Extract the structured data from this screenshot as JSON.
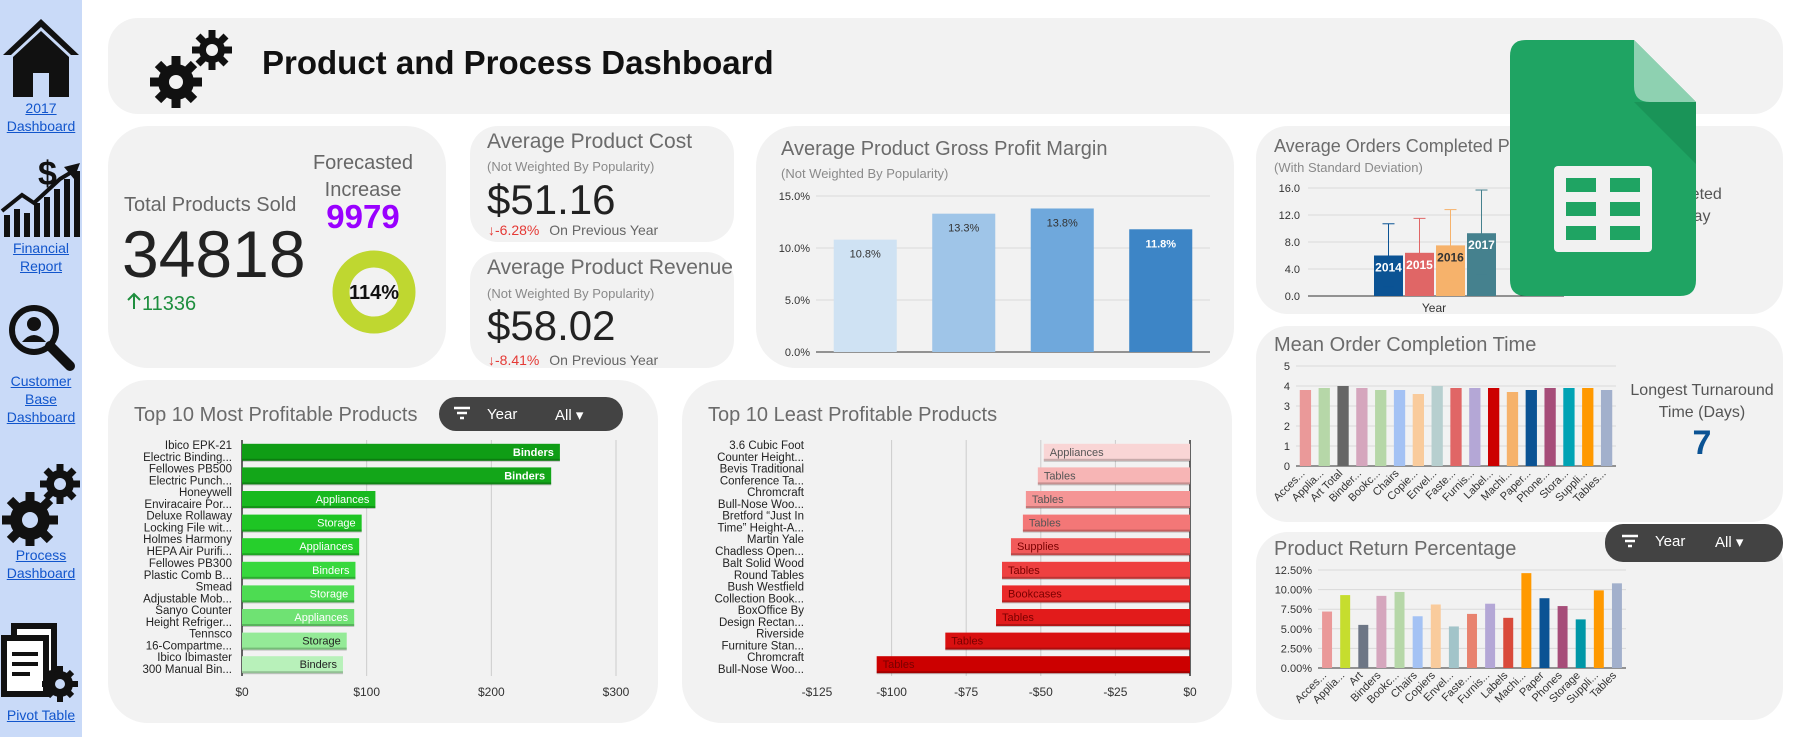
{
  "sidebar": {
    "items": [
      {
        "label1": "2017",
        "label2": "Dashboard",
        "icon": "house-icon"
      },
      {
        "label1": "Financial",
        "label2": "Report",
        "icon": "finance-chart-icon"
      },
      {
        "label1": "Customer",
        "label2": "Base",
        "label3": "Dashboard",
        "icon": "magnifier-user-icon"
      },
      {
        "label1": "Process",
        "label2": "Dashboard",
        "icon": "gears-icon"
      },
      {
        "label1": "Pivot Table",
        "icon": "documents-gear-icon"
      }
    ]
  },
  "header": {
    "title": "Product and Process Dashboard",
    "icon": "gears-icon"
  },
  "overlay_icon": "google-sheets-icon",
  "kpis": {
    "total_sold_label": "Total Products Sold",
    "total_sold": "34818",
    "total_sold_change": "11336",
    "forecast_label1": "Forecasted",
    "forecast_label2": "Increase",
    "forecast_value": "9979",
    "forecast_pct": "114%",
    "forecast_fraction": 1.0,
    "avg_cost_title": "Average Product Cost",
    "avg_cost_sub": "(Not Weighted By Popularity)",
    "avg_cost": "$51.16",
    "avg_cost_change": "-6.28%",
    "avg_cost_change_label": "On Previous Year",
    "avg_rev_title": "Average Product Revenue",
    "avg_rev_sub": "(Not Weighted By Popularity)",
    "avg_rev": "$58.02",
    "avg_rev_change": "-8.41%",
    "avg_rev_change_label": "On Previous Year",
    "orders_title": "Average Orders Completed P",
    "orders_sub": "(With Standard Deviation)",
    "orders_side1": "ompleted",
    "orders_side2": "Day",
    "longest_label1": "Longest Turnaround",
    "longest_label2": "Time (Days)",
    "longest_value": "7"
  },
  "filters": {
    "year_label": "Year",
    "all_label": "All"
  },
  "chart_titles": {
    "margin_title": "Average Product Gross Profit Margin",
    "margin_sub": "(Not Weighted By Popularity)",
    "top10_title": "Top 10 Most Profitable Products",
    "least10_title": "Top 10 Least Profitable Products",
    "mean_title": "Mean Order Completion Time",
    "return_title": "Product Return Percentage"
  },
  "chart_data": [
    {
      "type": "bar",
      "id": "margin",
      "title": "Average Product Gross Profit Margin",
      "subtitle": "(Not Weighted By Popularity)",
      "values": [
        10.8,
        13.3,
        13.8,
        11.8
      ],
      "labels": [
        "10.8%",
        "13.3%",
        "13.8%",
        "11.8%"
      ],
      "colors": [
        "#cfe2f3",
        "#9fc5e8",
        "#6fa8dc",
        "#3d85c6"
      ],
      "yticks": [
        "0.0%",
        "5.0%",
        "10.0%",
        "15.0%"
      ],
      "ylim": [
        0,
        15
      ]
    },
    {
      "type": "bar",
      "id": "orders",
      "title": "Average Orders Completed P",
      "subtitle": "(With Standard Deviation)",
      "xlabel": "Year",
      "categories": [
        "2014",
        "2015",
        "2016",
        "2017"
      ],
      "values": [
        6.0,
        6.4,
        7.5,
        9.3
      ],
      "err_low": [
        1.3,
        1.3,
        2.2,
        3.3
      ],
      "err_high": [
        10.7,
        11.5,
        12.8,
        15.7
      ],
      "colors": [
        "#0b5394",
        "#e06666",
        "#f6b26b",
        "#45818e"
      ],
      "yticks": [
        "0.0",
        "4.0",
        "8.0",
        "12.0",
        "16.0"
      ],
      "ylim": [
        0,
        16
      ]
    },
    {
      "type": "bar",
      "id": "top10",
      "title": "Top 10 Most Profitable Products",
      "orientation": "horizontal",
      "categories": [
        [
          "Ibico EPK-21",
          "Electric Binding..."
        ],
        [
          "Fellowes PB500",
          "Electric Punch..."
        ],
        [
          "Honeywell",
          "Enviracaire Por..."
        ],
        [
          "Deluxe Rollaway",
          "Locking File wit..."
        ],
        [
          "Holmes Harmony",
          "HEPA Air Purifi..."
        ],
        [
          "Fellowes PB300",
          "Plastic Comb B..."
        ],
        [
          "Smead",
          "Adjustable Mob..."
        ],
        [
          "Sanyo Counter",
          "Height Refriger..."
        ],
        [
          "Tennsco",
          "16-Compartme..."
        ],
        [
          "Ibico Ibimaster",
          "300 Manual Bin..."
        ]
      ],
      "values": [
        255,
        248,
        107,
        96,
        94,
        91,
        90,
        90,
        84,
        81
      ],
      "bar_labels": [
        "Binders",
        "Binders",
        "Appliances",
        "Storage",
        "Appliances",
        "Binders",
        "Storage",
        "Appliances",
        "Storage",
        "Binders"
      ],
      "colors": [
        "#0f9d15",
        "#13a619",
        "#18b91f",
        "#1ec524",
        "#26cf2c",
        "#37d83d",
        "#4ddc52",
        "#6fe273",
        "#94ea97",
        "#b8f1ba"
      ],
      "xticks": [
        "$0",
        "$100",
        "$200",
        "$300"
      ],
      "xlim": [
        0,
        300
      ]
    },
    {
      "type": "bar",
      "id": "least10",
      "title": "Top 10 Least Profitable Products",
      "orientation": "horizontal",
      "categories": [
        [
          "3.6 Cubic Foot",
          "Counter Height..."
        ],
        [
          "Bevis Traditional",
          "Conference Ta..."
        ],
        [
          "Chromcraft",
          "Bull-Nose Woo..."
        ],
        [
          "Bretford “Just In",
          "Time” Height-A..."
        ],
        [
          "Martin Yale",
          "Chadless Open..."
        ],
        [
          "Balt Solid Wood",
          "Round Tables"
        ],
        [
          "Bush Westfield",
          "Collection Book..."
        ],
        [
          "BoxOffice By",
          "Design Rectan..."
        ],
        [
          "Riverside",
          "Furniture Stan..."
        ],
        [
          "Chromcraft",
          "Bull-Nose Woo..."
        ]
      ],
      "values": [
        -49,
        -51,
        -55,
        -56,
        -60,
        -63,
        -63,
        -65,
        -82,
        -105
      ],
      "bar_labels": [
        "Appliances",
        "Tables",
        "Tables",
        "Tables",
        "Supplies",
        "Tables",
        "Bookcases",
        "Tables",
        "Tables",
        "Tables"
      ],
      "colors": [
        "#f9d5d5",
        "#f7b5b5",
        "#f59595",
        "#f37777",
        "#f15a5a",
        "#ee4040",
        "#ea2a2a",
        "#e21b1b",
        "#d91010",
        "#cc0000"
      ],
      "xticks": [
        "-$125",
        "-$100",
        "-$75",
        "-$50",
        "-$25",
        "$0"
      ],
      "xlim": [
        -125,
        0
      ]
    },
    {
      "type": "bar",
      "id": "mean",
      "title": "Mean Order Completion Time",
      "categories": [
        "Acces...",
        "Applia...",
        "Art Total",
        "Binder...",
        "Bookc...",
        "Chairs",
        "Copie...",
        "Envel...",
        "Faste...",
        "Furnis...",
        "Label...",
        "Machi...",
        "Paper...",
        "Phone...",
        "Stora...",
        "Suppli...",
        "Tables..."
      ],
      "values": [
        3.8,
        3.9,
        4.0,
        3.9,
        3.8,
        3.8,
        3.6,
        4.0,
        3.9,
        3.9,
        3.9,
        3.7,
        3.8,
        3.9,
        3.9,
        3.9,
        3.8
      ],
      "colors": [
        "#ea9999",
        "#b6d7a8",
        "#666666",
        "#d5a6bd",
        "#b6d7a8",
        "#a4c2f4",
        "#f9cb9c",
        "#b7cfcf",
        "#e06666",
        "#b4a7d6",
        "#cc0000",
        "#f6b26b",
        "#0b5394",
        "#a64d79",
        "#00a3b4",
        "#ff9900",
        "#a2b0cc"
      ],
      "yticks": [
        "0",
        "1",
        "2",
        "3",
        "4",
        "5"
      ],
      "ylim": [
        0,
        5
      ]
    },
    {
      "type": "bar",
      "id": "returns",
      "title": "Product Return Percentage",
      "categories": [
        "Acces...",
        "Applia...",
        "Art",
        "Binders",
        "Bookc...",
        "Chairs",
        "Copiers",
        "Envel...",
        "Faste...",
        "Furnis...",
        "Labels",
        "Machi...",
        "Paper",
        "Phones",
        "Storage",
        "Suppli...",
        "Tables"
      ],
      "values": [
        7.2,
        9.3,
        5.5,
        9.2,
        9.7,
        6.6,
        8.1,
        5.3,
        6.9,
        8.2,
        6.4,
        12.1,
        8.9,
        7.9,
        6.2,
        9.9,
        10.8
      ],
      "colors": [
        "#ea9999",
        "#c6dd2e",
        "#6d7685",
        "#d5a6bd",
        "#b6d7a8",
        "#a4c2f4",
        "#f9cb9c",
        "#a2c4c9",
        "#e8826f",
        "#b4a7d6",
        "#d94a3b",
        "#ff9900",
        "#0b5394",
        "#a64d79",
        "#0097a7",
        "#ff9900",
        "#a2b0cc"
      ],
      "yticks": [
        "0.00%",
        "2.50%",
        "5.00%",
        "7.50%",
        "10.00%",
        "12.50%"
      ],
      "ylim": [
        0,
        12.5
      ]
    }
  ]
}
